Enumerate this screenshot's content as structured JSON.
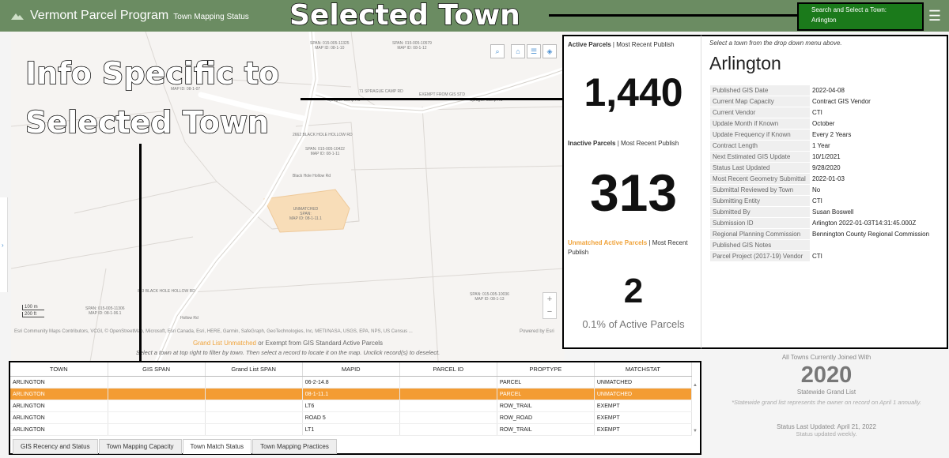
{
  "header": {
    "title": "Vermont Parcel Program",
    "subtitle": "Town Mapping Status",
    "menu_icon": "hamburger-icon"
  },
  "town_picker": {
    "label": "Search and Select a Town:",
    "value": "Arlington"
  },
  "annotations": {
    "selected_town": "Selected Town",
    "info_line1": "Info Specific to",
    "info_line2": "Selected Town"
  },
  "map": {
    "labels": [
      "SPAN: 015-005-11325\nMAP ID: 08-1-10",
      "SPAN: 015-005-10579\nMAP ID: 08-1-12",
      "MAP ID: 08-1-07",
      "71 SPRAGUE CAMP RD",
      "EXEMPT FROM GIS STD",
      "Sprague Camp Rd",
      "Sprague Camp Rd",
      "2662 BLACK HOLE HOLLOW RD",
      "SPAN: 015-005-10422\nMAP ID: 08-1-11",
      "Black Hole Hollow Rd",
      "UNMATCHED\nSPAN:\nMAP ID: 08-1-11.1",
      "843 BLACK HOLE HOLLOW RD",
      "SPAN: 015-005-11306\nMAP ID: 08-1-06.1",
      "SPAN: 015-005-10036\nMAP ID: 08-1-13",
      "Hollow Rd"
    ],
    "tools": [
      "search-icon",
      "home-icon",
      "list-icon",
      "layers-icon"
    ],
    "zoom_in": "+",
    "zoom_out": "−",
    "scale_m": "100 m",
    "scale_ft": "200 ft",
    "attribution": "Esri Community Maps Contributors, VCGI, © OpenStreetMap, Microsoft, Esri Canada, Esri, HERE, Garmin, SafeGraph, GeoTechnologies, Inc, METI/NASA, USGS, EPA, NPS, US Census ...",
    "powered_by": "Powered by Esri",
    "legend_orange": "Grand List Unmatched",
    "legend_or": "or Exempt from GIS Standard",
    "legend_active": "Active Parcels",
    "legend_hint": "Select a town at top right to filter by town. Then select a record to locate it on the map. Unclick record(s) to deselect."
  },
  "stats": {
    "active": {
      "label": "Active Parcels",
      "sep": " | ",
      "sub": "Most Recent Publish",
      "value": "1,440"
    },
    "inactive": {
      "label": "Inactive Parcels",
      "sep": " | ",
      "sub": "Most Recent Publish",
      "value": "313"
    },
    "unmatched": {
      "label": "Unmatched Active Parcels",
      "sep": " | ",
      "sub": "Most Recent Publish",
      "value": "2",
      "footer": "0.1% of Active Parcels"
    }
  },
  "details": {
    "hint": "Select a town from the drop down menu above.",
    "town": "Arlington",
    "rows": [
      {
        "key": "Published GIS Date",
        "value": "2022-04-08"
      },
      {
        "key": "Current Map Capacity",
        "value": "Contract GIS Vendor"
      },
      {
        "key": "Current Vendor",
        "value": "CTI"
      },
      {
        "key": "Update Month if Known",
        "value": "October"
      },
      {
        "key": "Update Frequency if Known",
        "value": "Every 2 Years"
      },
      {
        "key": "Contract Length",
        "value": "1 Year"
      },
      {
        "key": "Next Estimated GIS Update",
        "value": "10/1/2021"
      },
      {
        "key": "Status Last Updated",
        "value": "9/28/2020"
      },
      {
        "key": "Most Recent Geometry Submittal",
        "value": "2022-01-03"
      },
      {
        "key": "Submittal Reviewed by Town",
        "value": "No"
      },
      {
        "key": "Submitting Entity",
        "value": "CTI"
      },
      {
        "key": "Submitted By",
        "value": "Susan Boswell"
      },
      {
        "key": "Submission ID",
        "value": "Arlington 2022-01-03T14:31:45.000Z"
      },
      {
        "key": "Regional Planning Commission",
        "value": "Bennington County Regional Commission"
      },
      {
        "key": "Published GIS Notes",
        "value": ""
      },
      {
        "key": "Parcel Project (2017-19) Vendor",
        "value": "CTI"
      }
    ]
  },
  "summary": {
    "line": "All Towns Currently Joined With",
    "year": "2020",
    "sub": "Statewide Grand List",
    "note": "*Statewide grand list represents the owner on record on April 1 annually.",
    "updated": "Status Last Updated: April 21, 2022",
    "weekly": "Status updated weekly."
  },
  "grid": {
    "columns": [
      "TOWN",
      "GIS SPAN",
      "Grand List SPAN",
      "MAPID",
      "PARCEL ID",
      "PROPTYPE",
      "MATCHSTAT"
    ],
    "rows": [
      [
        "ARLINGTON",
        "",
        "",
        "06-2-14.8",
        "",
        "PARCEL",
        "UNMATCHED"
      ],
      [
        "ARLINGTON",
        "",
        "",
        "08-1-11.1",
        "",
        "PARCEL",
        "UNMATCHED"
      ],
      [
        "ARLINGTON",
        "",
        "",
        "LT6",
        "",
        "ROW_TRAIL",
        "EXEMPT"
      ],
      [
        "ARLINGTON",
        "",
        "",
        "ROAD 5",
        "",
        "ROW_ROAD",
        "EXEMPT"
      ],
      [
        "ARLINGTON",
        "",
        "",
        "LT1",
        "",
        "ROW_TRAIL",
        "EXEMPT"
      ]
    ],
    "selected_row": 1,
    "tabs": [
      "GIS Recency and Status",
      "Town Mapping Capacity",
      "Town Match Status",
      "Town Mapping Practices"
    ],
    "active_tab": 2
  },
  "colors": {
    "header": "#6b8c62",
    "picker": "#1b7a1b",
    "unmatched": "#f0a33a",
    "selected_row": "#f39c33",
    "unmatched_parcel_fill": "#f8ddb8"
  }
}
